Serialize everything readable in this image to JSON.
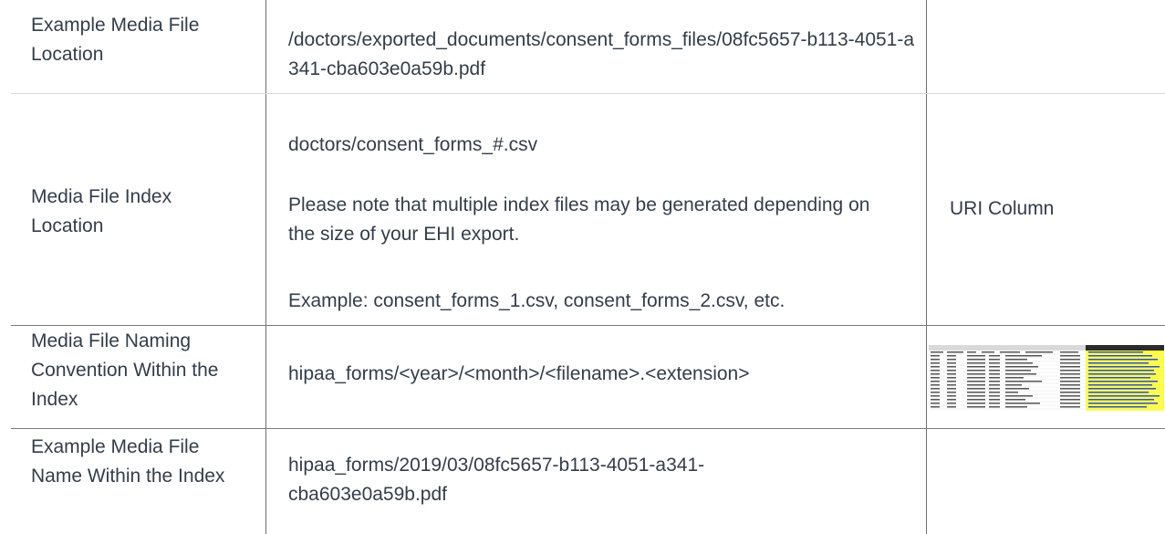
{
  "table": {
    "rows": [
      {
        "label": "Example Media File Location",
        "value": "/doctors/exported_documents/consent_forms_files/08fc5657-b113-4051-a341-cba603e0a59b.pdf",
        "extra": ""
      },
      {
        "label": "Media File Index Location",
        "value_lines": [
          "doctors/consent_forms_#.csv",
          "Please note that multiple index files may be generated depending on the size of your EHI export.",
          "Example: consent_forms_1.csv, consent_forms_2.csv, etc."
        ],
        "extra": "URI Column"
      },
      {
        "label": "Media File Naming Convention Within the Index",
        "value": "hipaa_forms/<year>/<month>/<filename>.<extension>",
        "extra_image": "spreadsheet-thumbnail"
      },
      {
        "label": "Example Media File Name Within the Index",
        "value": "hipaa_forms/2019/03/08fc5657-b113-4051-a341-cba603e0a59b.pdf",
        "extra": ""
      }
    ]
  }
}
